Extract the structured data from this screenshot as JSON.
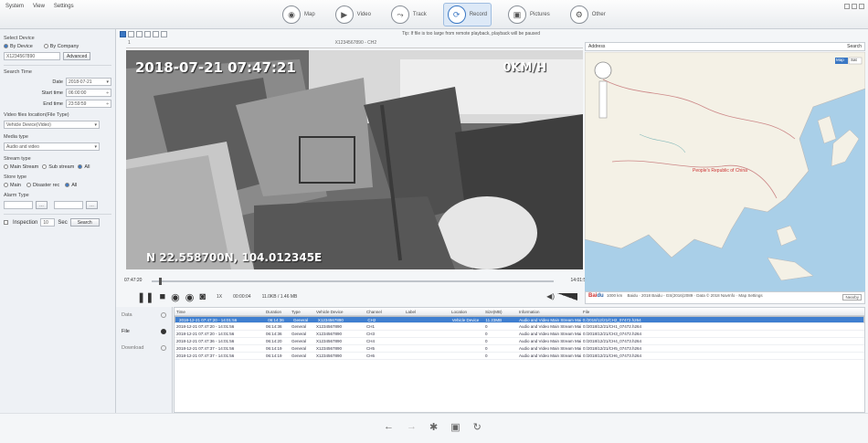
{
  "menu": [
    "System",
    "View",
    "Settings"
  ],
  "nav_tabs": [
    {
      "label": "Map",
      "icon": "map-icon"
    },
    {
      "label": "Video",
      "icon": "video-icon"
    },
    {
      "label": "Track",
      "icon": "track-icon"
    },
    {
      "label": "Record",
      "icon": "record-icon",
      "active": true
    },
    {
      "label": "Pictures",
      "icon": "pictures-icon"
    },
    {
      "label": "Other",
      "icon": "other-icon"
    }
  ],
  "left_panel": {
    "select_device": "Select Device",
    "by_device": "By Device",
    "by_company": "By Company",
    "device_value": "X1234567890",
    "advanced_btn": "Advanced",
    "search_time": "Search Time",
    "date_label": "Date",
    "date_value": "2018-07-21",
    "start_label": "Start time",
    "start_value": "06:00:00",
    "end_label": "End time",
    "end_value": "23:59:59",
    "location_label": "Video files location(File Type)",
    "location_value": "Vehicle Device(Video)",
    "media_label": "Media type",
    "media_value": "Audio and video",
    "stream_label": "Stream type",
    "stream_main": "Main Stream",
    "stream_sub": "Sub stream",
    "stream_all": "All",
    "store_label": "Store type",
    "store_main": "Main",
    "store_disaster": "Disaster rec",
    "store_all": "All",
    "alarm_label": "Alarm Type",
    "inspection_label": "Inspection",
    "inspection_value": "10",
    "sec_label": "Sec",
    "search_btn": "Search"
  },
  "video": {
    "tip": "Tip: If file is too large from remote playback, playback will be paused",
    "header_left": "1",
    "header_center": "X1234567890 - CH2",
    "osd_top": "2018-07-21 07:47:21",
    "osd_right": "0KM/H",
    "osd_bottom": "N 22.558700N, 104.012345E",
    "time_start": "07:47:20",
    "time_end": "14:01:56",
    "speed": "1X",
    "elapsed": "00:00:04",
    "stats": "11.0KB / 1.46 MB"
  },
  "map": {
    "address_label": "Address",
    "search_btn": "Search",
    "map_type": "Map",
    "satellite": "Sat",
    "center_label": "People's Republic of China",
    "footer_text": "Baidu · 2018 Baidu - GS(2016)2089 · Data © 2018 NavInfo · Map Settings",
    "scale_label": "1000 km",
    "nearby_btn": "Nearby"
  },
  "list": {
    "side_tabs": [
      {
        "label": "Data",
        "active": false
      },
      {
        "label": "File",
        "active": true
      },
      {
        "label": "Download",
        "active": false
      }
    ],
    "columns": [
      "Time",
      "Duration",
      "Type",
      "Vehicle Device",
      "Channel",
      "Label",
      "Location",
      "Size(MB)",
      "Information",
      "File"
    ],
    "rows": [
      [
        "2018-12-21 07:47:20 - 14:01:56",
        "06:14:36",
        "General",
        "X1234567890",
        "CH2",
        "",
        "Vehicle Device",
        "11.23MB",
        "Audio and Video Main Stream Main m",
        "0:/2018/12/21/CH2_07472.h264"
      ],
      [
        "2018-12-21 07:47:20 - 14:01:56",
        "06:14:36",
        "General",
        "X1234567890",
        "CH1",
        "",
        "",
        "0",
        "Audio and Video Main Stream Main m",
        "0:/2018/12/21/CH1_07472.h264"
      ],
      [
        "2018-12-21 07:47:20 - 14:01:56",
        "06:14:36",
        "General",
        "X1234567890",
        "CH3",
        "",
        "",
        "0",
        "Audio and Video Main Stream Main m",
        "0:/2018/12/21/CH3_07472.h264"
      ],
      [
        "2018-12-21 07:47:36 - 14:01:56",
        "06:14:20",
        "General",
        "X1234567890",
        "CH4",
        "",
        "",
        "0",
        "Audio and Video Main Stream Main m",
        "0:/2018/12/21/CH4_07473.h264"
      ],
      [
        "2018-12-21 07:47:37 - 14:01:56",
        "06:14:19",
        "General",
        "X1234567890",
        "CH5",
        "",
        "",
        "0",
        "Audio and Video Main Stream Main m",
        "0:/2018/12/21/CH5_07473.h264"
      ],
      [
        "2018-12-21 07:47:37 - 14:01:56",
        "06:14:19",
        "General",
        "X1234567890",
        "CH6",
        "",
        "",
        "0",
        "Audio and Video Main Stream Main m",
        "0:/2018/12/21/CH6_07473.h264"
      ]
    ]
  },
  "colors": {
    "accent": "#3b78c4",
    "selected_row": "#3f7fd0",
    "sea": "#a9cfe8",
    "land": "#f4f1e6"
  }
}
